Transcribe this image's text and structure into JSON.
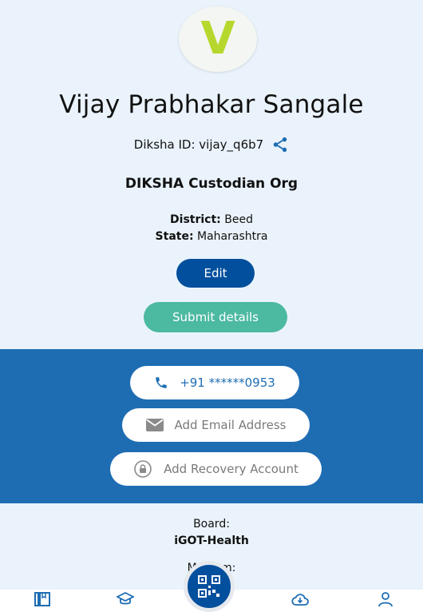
{
  "profile": {
    "avatar_letter": "V",
    "name": "Vijay Prabhakar Sangale",
    "diksha_id": "Diksha ID: vijay_q6b7",
    "org": "DIKSHA Custodian Org",
    "district_label": "District:",
    "district_value": "Beed",
    "state_label": "State:",
    "state_value": "Maharashtra"
  },
  "actions": {
    "edit_label": "Edit",
    "submit_label": "Submit details"
  },
  "contact": {
    "phone": "+91 ******0953",
    "email_placeholder": "Add Email Address",
    "recovery_placeholder": "Add Recovery Account"
  },
  "details": {
    "board_label": "Board:",
    "board_value": "iGOT-Health",
    "medium_label": "Medium:"
  },
  "bottom_nav": [
    "library-icon",
    "courses-icon",
    "qr-scan-icon",
    "downloads-icon",
    "profile-icon"
  ],
  "colors": {
    "primary": "#024f9d",
    "submit": "#4cb9a1",
    "band": "#1e6db3",
    "avatar_letter": "#b6d82e"
  }
}
